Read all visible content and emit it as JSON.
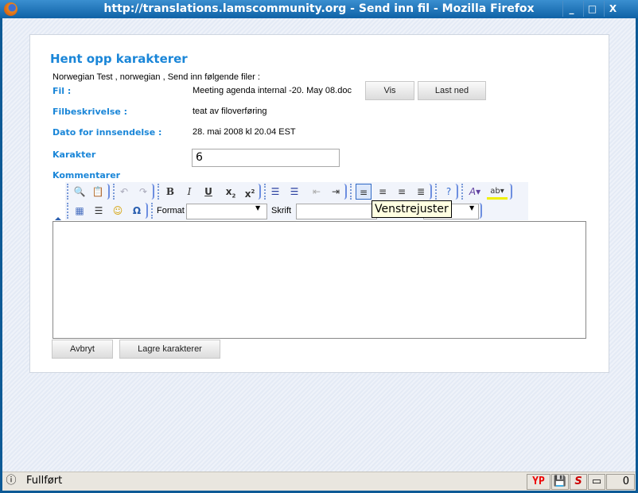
{
  "window": {
    "title": "http://translations.lamscommunity.org - Send inn fil - Mozilla Firefox",
    "min": "_",
    "max": "□",
    "close": "X"
  },
  "page": {
    "title": "Hent opp karakterer",
    "intro": "Norwegian Test , norwegian , Send inn følgende filer :",
    "file_label": "Fil :",
    "file_value": "Meeting agenda internal -20. May 08.doc",
    "view_button": "Vis",
    "download_button": "Last ned",
    "desc_label": "Filbeskrivelse :",
    "desc_value": "teat av filoverføring",
    "date_label": "Dato for innsendelse :",
    "date_value": "28. mai 2008 kl 20.04 EST",
    "grade_label": "Karakter",
    "grade_value": "6",
    "comments_label": "Kommentarer",
    "cancel_button": "Avbryt",
    "save_button": "Lagre karakterer"
  },
  "editor": {
    "format_label": "Format",
    "format_value": "",
    "font_label": "Skrift",
    "font_value": "",
    "size_value": "",
    "tooltip": "Venstrejuster",
    "active_tool": "align-left",
    "tools_row1": [
      "preview",
      "paste-word",
      "undo",
      "redo",
      "bold",
      "italic",
      "underline",
      "subscript",
      "superscript",
      "ordered-list",
      "unordered-list",
      "outdent",
      "indent",
      "align-left",
      "align-center",
      "align-right",
      "justify",
      "help",
      "text-color",
      "background-color"
    ],
    "tools_row2": [
      "table",
      "horizontal-rule",
      "smiley",
      "special-char"
    ]
  },
  "statusbar": {
    "text": "Fullført",
    "yp": "YP",
    "counter": "0"
  }
}
